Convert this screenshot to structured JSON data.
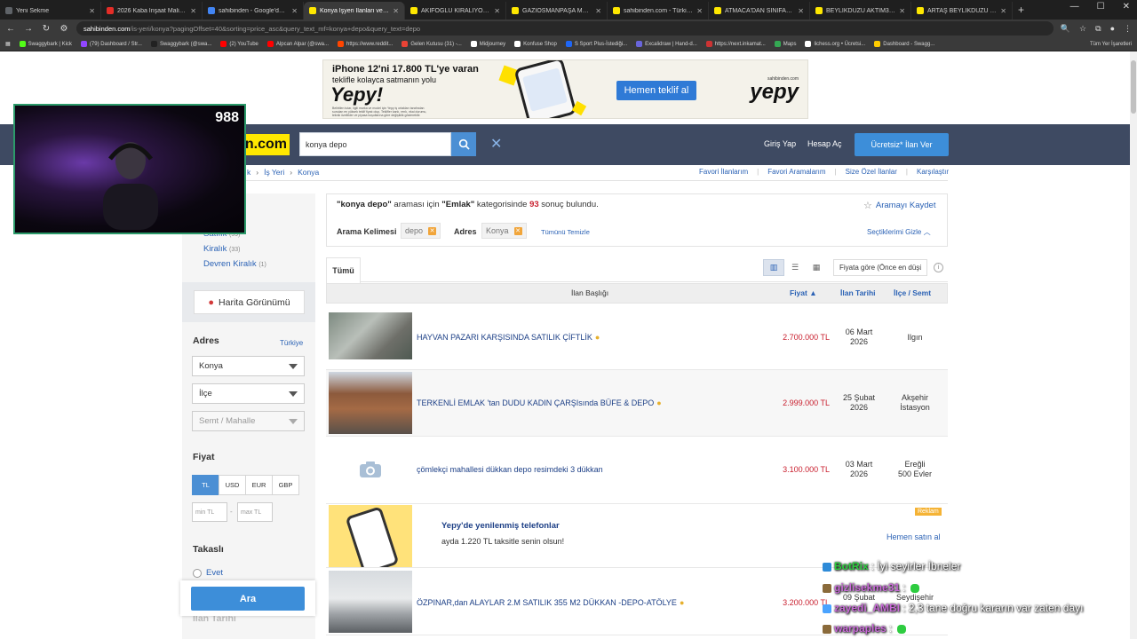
{
  "browser": {
    "tabs": [
      {
        "title": "Yeni Sekme",
        "color": "#5f6368"
      },
      {
        "title": "2026 Kaba İnşaat Maliyeti Ne",
        "color": "#e52d27"
      },
      {
        "title": "sahibinden - Google'da Ara",
        "color": "#4285f4"
      },
      {
        "title": "Konya İşyeri İlanları ve Fiyatla",
        "color": "#ffe800",
        "active": true
      },
      {
        "title": "AKIFOĞLU KİRALIYOR BUĞDA",
        "color": "#ffe800"
      },
      {
        "title": "GAZIOSMANPAŞA MAH. MER",
        "color": "#ffe800"
      },
      {
        "title": "sahibinden.com - Türkiye'nin",
        "color": "#ffe800"
      },
      {
        "title": "ATMACA'DAN SINIFAŞ İŞ MER",
        "color": "#ffe800"
      },
      {
        "title": "BEYLİKDÜZÜ AKTİM3 KİRALI",
        "color": "#ffe800"
      },
      {
        "title": "ARTAŞ BEYLİKDÜZÜ 135 m2 İ",
        "color": "#ffe800"
      }
    ],
    "url_host": "sahibinden.com",
    "url_path": "/is-yeri/konya?pagingOffset=40&sorting=price_asc&query_text_mf=konya+depo&query_text=depo",
    "bookmarks": [
      {
        "label": "Swaggybark | Kick",
        "color": "#53fc18"
      },
      {
        "label": "(79) Dashboard / Str...",
        "color": "#9146ff"
      },
      {
        "label": "Swaggybark (@swa...",
        "color": "#222222"
      },
      {
        "label": "(2) YouTube",
        "color": "#ff0000"
      },
      {
        "label": "Alpcan Alpar (@swa...",
        "color": "#ff0000"
      },
      {
        "label": "https://www.reddit...",
        "color": "#ff4500"
      },
      {
        "label": "Gelen Kutusu (31) -...",
        "color": "#ea4335"
      },
      {
        "label": "Midjourney",
        "color": "#ffffff"
      },
      {
        "label": "Konfuse Shop",
        "color": "#ffffff"
      },
      {
        "label": "S Sport Plus-İstediği...",
        "color": "#1e66f5"
      },
      {
        "label": "Excalidraw | Hand-d...",
        "color": "#6965db"
      },
      {
        "label": "https://next.inkamat...",
        "color": "#cc3333"
      },
      {
        "label": "Maps",
        "color": "#34a853"
      },
      {
        "label": "lichess.org • Ücretsi...",
        "color": "#ffffff"
      },
      {
        "label": "Dashboard - Swagg...",
        "color": "#ffcc00"
      }
    ],
    "bookmarks_right": "Tüm Yer İşaretleri"
  },
  "banner": {
    "line1": "iPhone 12'ni 17.800 TL'ye varan",
    "line2": "teklifle kolayca satmanın yolu",
    "brand_big": "Yepy!",
    "fine_print": "Belirtilen tutar, ilgili marka ve model için Yepy iş ortakları tarafından sunulan en yüksek teklif fiyatı olup, Teklifler kanlı, renk, ırkai durumu, teknik özellikler ve piyasa koşullarına göre değişiklik gösterebilir.",
    "cta": "Hemen teklif al",
    "brand_small": "sahibinden.com",
    "brand_name": "yepy"
  },
  "header": {
    "logo_text": "in.com",
    "search_value": "konya depo",
    "login": "Giriş Yap",
    "register": "Hesap Aç",
    "free_ad": "Ücretsiz* İlan Ver"
  },
  "breadcrumb": [
    "k",
    "İş Yeri",
    "Konya"
  ],
  "toplinks": [
    "Favori İlanlarım",
    "Favori Aramalarım",
    "Size Özel İlanlar",
    "Karşılaştır"
  ],
  "sidebar": {
    "categories": [
      {
        "label": "Satılık",
        "count": "(59)"
      },
      {
        "label": "Kiralık",
        "count": "(33)"
      },
      {
        "label": "Devren Kiralık",
        "count": "(1)"
      }
    ],
    "map_button": "Harita Görünümü",
    "address_title": "Adres",
    "address_country": "Türkiye",
    "city": "Konya",
    "district": "İlçe",
    "neighborhood": "Semt / Mahalle",
    "price_title": "Fiyat",
    "currencies": [
      "TL",
      "USD",
      "EUR",
      "GBP"
    ],
    "min_placeholder": "min TL",
    "max_placeholder": "max TL",
    "swap_title": "Takaslı",
    "swap_yes": "Evet",
    "search_button": "Ara",
    "next_title": "İlan Tarihi"
  },
  "results": {
    "summary_query": "\"konya depo\"",
    "summary_mid": " araması için ",
    "summary_category": "\"Emlak\"",
    "summary_cat_suffix": " kategorisinde ",
    "count": "93",
    "summary_end": " sonuç bulundu.",
    "save_search": "Aramayı Kaydet",
    "filter_keyword_label": "Arama Kelimesi",
    "filter_keyword_value": "depo",
    "filter_address_label": "Adres",
    "filter_address_value": "Konya",
    "clear_all": "Tümünü Temizle",
    "hide_selected": "Seçtiklerimi Gizle",
    "tab_all": "Tümü",
    "sort_value": "Fiyata göre (Önce en düşük)",
    "columns": {
      "title": "İlan Başlığı",
      "price": "Fiyat",
      "date": "İlan Tarihi",
      "district": "İlçe / Semt"
    },
    "listings": [
      {
        "title": "HAYVAN PAZARI KARŞISINDA SATILIK ÇİFTLİK",
        "price": "2.700.000 TL",
        "date1": "06 Mart",
        "date2": "2026",
        "loc1": "Ilgın",
        "loc2": ""
      },
      {
        "title": "TERKENLİ EMLAK 'tan DUDU KADIN ÇARŞIsında BÜFE & DEPO",
        "price": "2.999.000 TL",
        "date1": "25 Şubat",
        "date2": "2026",
        "loc1": "Akşehir",
        "loc2": "İstasyon"
      },
      {
        "title": "çömlekçi mahallesi dükkan depo resimdeki 3 dükkan",
        "price": "3.100.000 TL",
        "date1": "03 Mart",
        "date2": "2026",
        "loc1": "Ereğli",
        "loc2": "500 Evler"
      },
      {
        "title": "ÖZPINAR,dan ALAYLAR 2.M SATILIK 355 M2 DÜKKAN -DEPO-ATÖLYE",
        "price": "3.200.000 TL",
        "date1": "09 Şubat",
        "date2": "",
        "loc1": "Seydişehir",
        "loc2": ""
      }
    ],
    "ad": {
      "title": "Yepy'de yenilenmiş telefonlar",
      "subtitle": "ayda 1.220 TL taksitle senin olsun!",
      "badge": "Reklam",
      "cta": "Hemen satın al"
    }
  },
  "stream": {
    "viewer_count": "988",
    "chat": [
      {
        "user": "BotRix",
        "msg": ": İyi seyirler İbneler",
        "color": "#2ecc40"
      },
      {
        "user": "gizlisekme31",
        "msg": ":",
        "color": "#c96bd8"
      },
      {
        "user": "zayedi_AMBI",
        "msg": ": 2,3 tane doğru kararın var zaten dayı",
        "color": "#c96bd8"
      },
      {
        "user": "warpaples",
        "msg": ":",
        "color": "#c96bd8"
      }
    ]
  }
}
